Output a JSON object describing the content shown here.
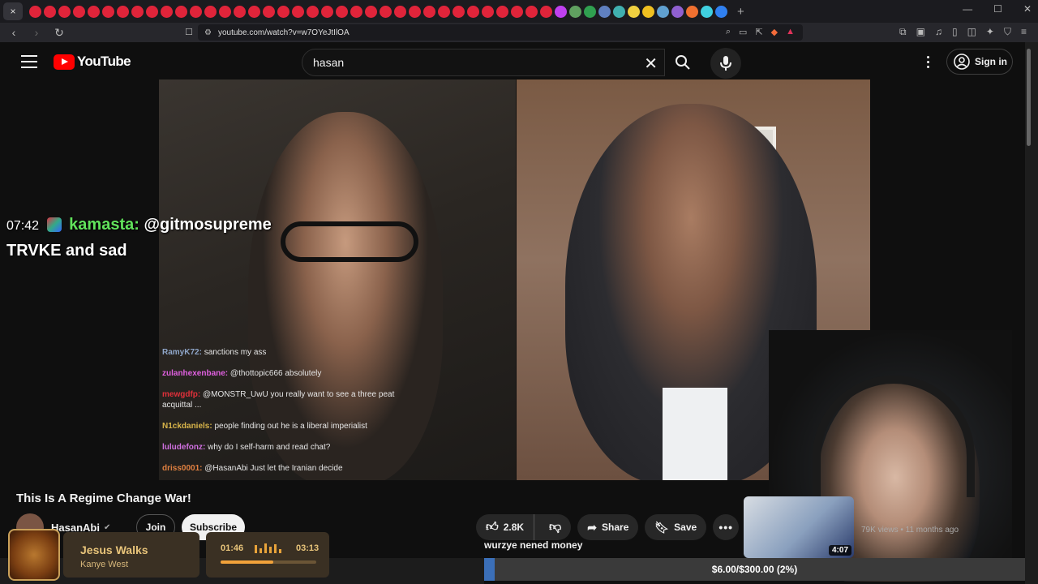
{
  "browser": {
    "url": "youtube.com/watch?v=w7OYeJtIlOA",
    "tab_close_glyph": "×",
    "new_tab_glyph": "+"
  },
  "youtube": {
    "logo_text": "YouTube",
    "search_value": "hasan",
    "sign_in_label": "Sign in"
  },
  "overlay": {
    "time": "07:42",
    "username": "kamasta",
    "separator": ":",
    "mention": "@gitmosupreme",
    "message": "TRVKE and sad"
  },
  "chat": [
    {
      "user": "RamyK72:",
      "text": "sanctions my ass",
      "color": "#8fa6c9"
    },
    {
      "user": "zulanhexenbane:",
      "text": "@thottopic666 absolutely",
      "color": "#e060e0"
    },
    {
      "user": "mewgdfp:",
      "text": "@MONSTR_UwU you really want to see a three peat acquittal ...",
      "color": "#e0303a"
    },
    {
      "user": "N1ckdaniels:",
      "text": "people finding out he is a liberal imperialist",
      "color": "#d9b54a"
    },
    {
      "user": "luludefonz:",
      "text": "why do I self-harm and read chat?",
      "color": "#d070e0"
    },
    {
      "user": "driss0001:",
      "text": "@HasanAbi Just let the Iranian decide",
      "color": "#e08040"
    }
  ],
  "video": {
    "title": "This Is A Regime Change War!",
    "channel": "HasanAbi",
    "join_label": "Join",
    "subscribe_label": "Subscribe",
    "likes": "2.8K",
    "share_label": "Share",
    "save_label": "Save"
  },
  "recommendation": {
    "duration": "4:07",
    "meta": "79K views • 11 months ago"
  },
  "stream_overlay": {
    "donation_text": "wurzye nened money",
    "goal_text": "$6.00/$300.00 (2%)",
    "goal_fraction": 0.02
  },
  "music": {
    "title": "Jesus Walks",
    "artist": "Kanye West",
    "current": "01:46",
    "total": "03:13",
    "progress": 0.55
  },
  "colors": {
    "yt_red": "#ff0000",
    "overlay_user": "#61e25b",
    "goal_fill": "#3b6fb8",
    "music_accent": "#e8c47a"
  }
}
